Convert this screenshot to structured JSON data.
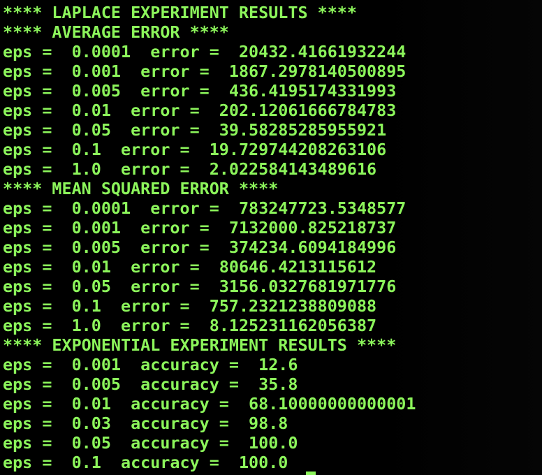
{
  "terminal": {
    "text_color": "#8cf55b",
    "background_color": "#000000",
    "lines": [
      "**** LAPLACE EXPERIMENT RESULTS ****",
      "**** AVERAGE ERROR ****",
      "eps =  0.0001  error =  20432.41661932244",
      "eps =  0.001  error =  1867.2978140500895",
      "eps =  0.005  error =  436.4195174331993",
      "eps =  0.01  error =  202.12061666784783",
      "eps =  0.05  error =  39.58285285955921",
      "eps =  0.1  error =  19.729744208263106",
      "eps =  1.0  error =  2.022584143489616",
      "**** MEAN SQUARED ERROR ****",
      "eps =  0.0001  error =  783247723.5348577",
      "eps =  0.001  error =  7132000.825218737",
      "eps =  0.005  error =  374234.6094184996",
      "eps =  0.01  error =  80646.4213115612",
      "eps =  0.05  error =  3156.0327681971776",
      "eps =  0.1  error =  757.2321238809088",
      "eps =  1.0  error =  8.125231162056387",
      "**** EXPONENTIAL EXPERIMENT RESULTS ****",
      "eps =  0.001  accuracy =  12.6",
      "eps =  0.005  accuracy =  35.8",
      "eps =  0.01  accuracy =  68.10000000000001",
      "eps =  0.03  accuracy =  98.8",
      "eps =  0.05  accuracy =  100.0",
      "eps =  0.1  accuracy =  100.0"
    ]
  }
}
